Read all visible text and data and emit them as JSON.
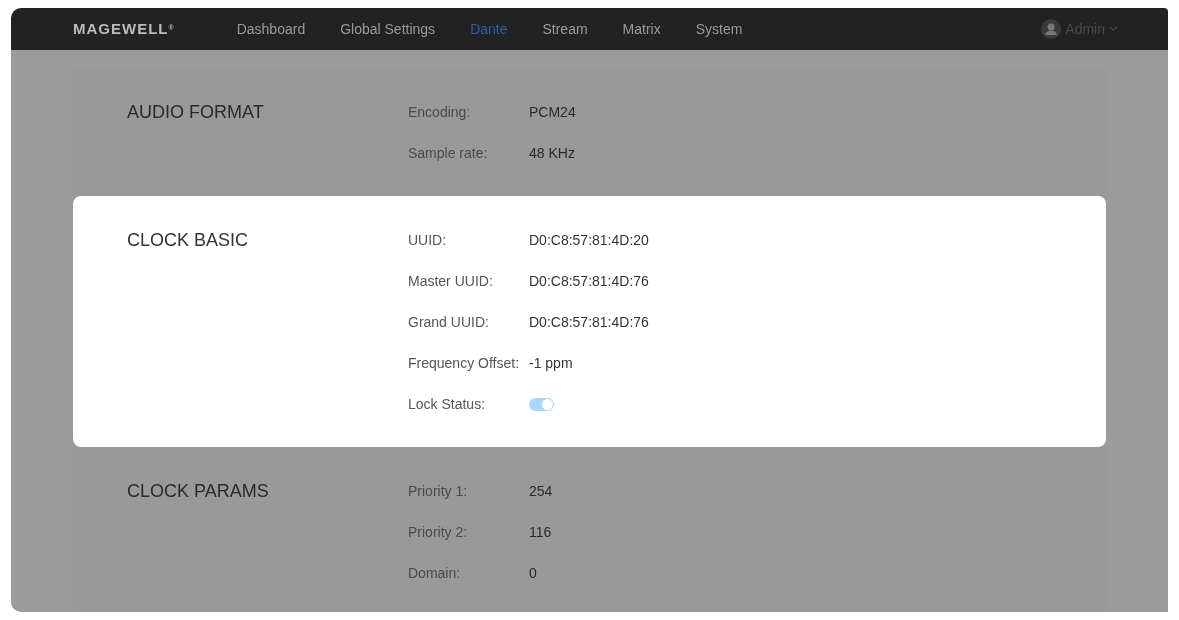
{
  "nav": {
    "logo": "MAGEWELL",
    "logo_mark": "®",
    "items": [
      {
        "label": "Dashboard",
        "selected": false
      },
      {
        "label": "Global Settings",
        "selected": false
      },
      {
        "label": "Dante",
        "selected": true
      },
      {
        "label": "Stream",
        "selected": false
      },
      {
        "label": "Matrix",
        "selected": false
      },
      {
        "label": "System",
        "selected": false
      }
    ],
    "user": "Admin"
  },
  "sections": [
    {
      "title": "AUDIO FORMAT",
      "highlighted": false,
      "rows": [
        {
          "kind": "text",
          "label": "Encoding:",
          "value": "PCM24"
        },
        {
          "kind": "text",
          "label": "Sample rate:",
          "value": "48 KHz"
        }
      ]
    },
    {
      "title": "CLOCK BASIC",
      "highlighted": true,
      "rows": [
        {
          "kind": "text",
          "label": "UUID:",
          "value": "D0:C8:57:81:4D:20"
        },
        {
          "kind": "text",
          "label": "Master UUID:",
          "value": "D0:C8:57:81:4D:76"
        },
        {
          "kind": "text",
          "label": "Grand UUID:",
          "value": "D0:C8:57:81:4D:76"
        },
        {
          "kind": "text",
          "label": "Frequency Offset:",
          "value": "-1 ppm"
        },
        {
          "kind": "toggle",
          "label": "Lock Status:",
          "on": true
        }
      ]
    },
    {
      "title": "CLOCK PARAMS",
      "highlighted": false,
      "rows": [
        {
          "kind": "text",
          "label": "Priority 1:",
          "value": "254"
        },
        {
          "kind": "text",
          "label": "Priority 2:",
          "value": "116"
        },
        {
          "kind": "text",
          "label": "Domain:",
          "value": "0"
        }
      ]
    }
  ]
}
